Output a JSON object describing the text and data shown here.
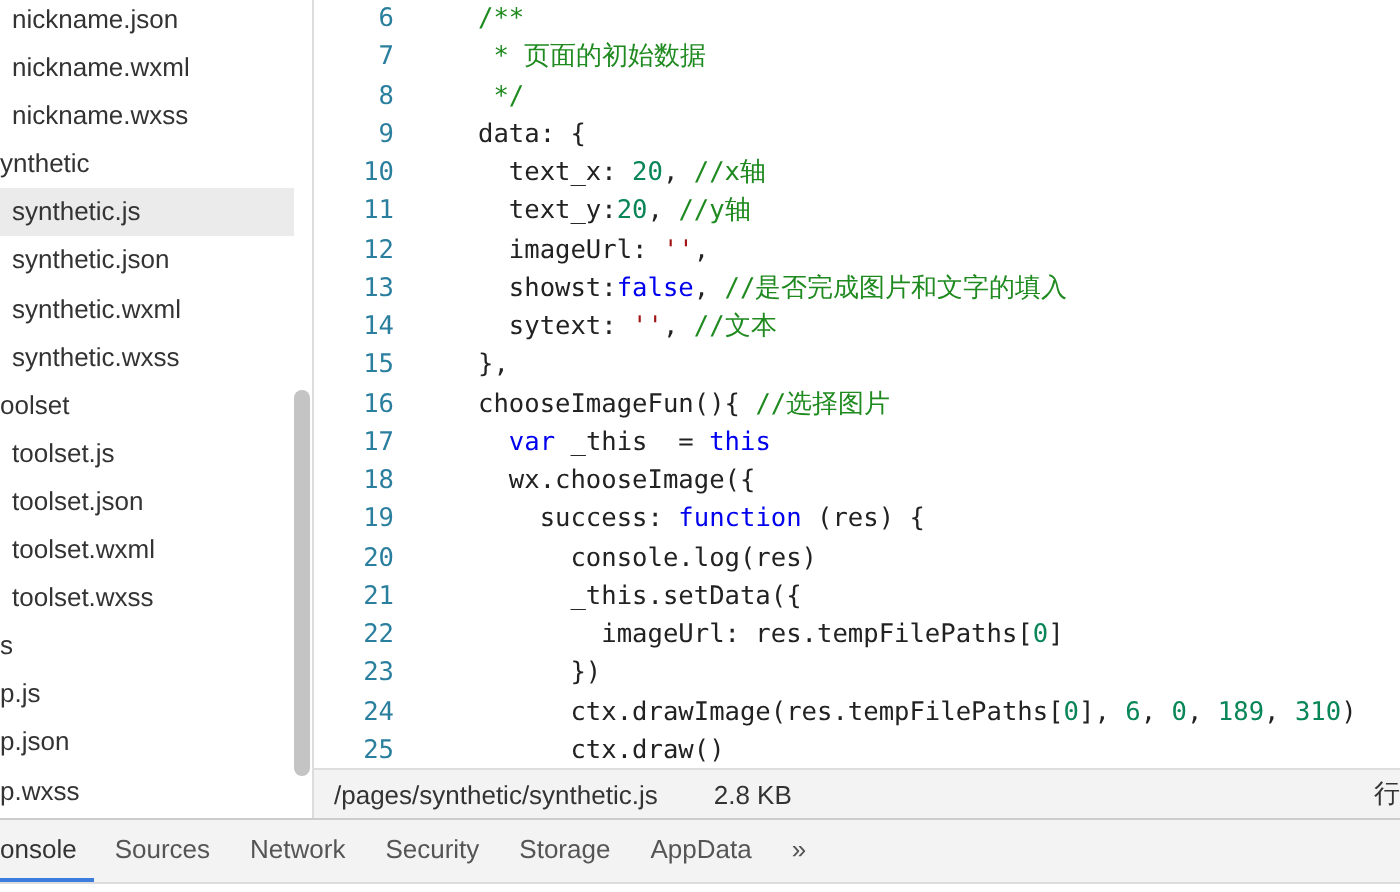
{
  "sidebar": {
    "tree": [
      {
        "children": [
          {
            "label": "nickname.json",
            "selected": false
          },
          {
            "label": "nickname.wxml",
            "selected": false
          },
          {
            "label": "nickname.wxss",
            "selected": false
          }
        ]
      },
      {
        "label": "ynthetic",
        "selected": false,
        "children": [
          {
            "label": "synthetic.js",
            "selected": true
          },
          {
            "label": "synthetic.json",
            "selected": false
          },
          {
            "label": "synthetic.wxml",
            "selected": false
          },
          {
            "label": "synthetic.wxss",
            "selected": false
          }
        ]
      },
      {
        "label": "oolset",
        "selected": false,
        "children": [
          {
            "label": "toolset.js",
            "selected": false
          },
          {
            "label": "toolset.json",
            "selected": false
          },
          {
            "label": "toolset.wxml",
            "selected": false
          },
          {
            "label": "toolset.wxss",
            "selected": false
          }
        ]
      },
      {
        "label": "s",
        "selected": false
      },
      {
        "label": "p.js",
        "selected": false
      },
      {
        "label": "p.json",
        "selected": false
      },
      {
        "label": "p.wxss",
        "selected": false
      }
    ]
  },
  "editor": {
    "lines": [
      {
        "number": "6",
        "tokens": [
          {
            "kind": "comment",
            "text": "/**"
          }
        ]
      },
      {
        "number": "7",
        "tokens": [
          {
            "kind": "comment",
            "text": " * 页面的初始数据"
          }
        ]
      },
      {
        "number": "8",
        "tokens": [
          {
            "kind": "comment",
            "text": " */"
          }
        ]
      },
      {
        "number": "9",
        "tokens": [
          {
            "kind": "plain",
            "text": "data: {"
          }
        ]
      },
      {
        "number": "10",
        "tokens": [
          {
            "kind": "plain",
            "text": "  text_x: "
          },
          {
            "kind": "number",
            "text": "20"
          },
          {
            "kind": "plain",
            "text": ", "
          },
          {
            "kind": "comment",
            "text": "//x轴"
          }
        ]
      },
      {
        "number": "11",
        "tokens": [
          {
            "kind": "plain",
            "text": "  text_y:"
          },
          {
            "kind": "number",
            "text": "20"
          },
          {
            "kind": "plain",
            "text": ", "
          },
          {
            "kind": "comment",
            "text": "//y轴"
          }
        ]
      },
      {
        "number": "12",
        "tokens": [
          {
            "kind": "plain",
            "text": "  imageUrl: "
          },
          {
            "kind": "string",
            "text": "''"
          },
          {
            "kind": "plain",
            "text": ","
          }
        ]
      },
      {
        "number": "13",
        "tokens": [
          {
            "kind": "plain",
            "text": "  showst:"
          },
          {
            "kind": "keyword",
            "text": "false"
          },
          {
            "kind": "plain",
            "text": ", "
          },
          {
            "kind": "comment",
            "text": "//是否完成图片和文字的填入"
          }
        ]
      },
      {
        "number": "14",
        "tokens": [
          {
            "kind": "plain",
            "text": "  sytext: "
          },
          {
            "kind": "string",
            "text": "''"
          },
          {
            "kind": "plain",
            "text": ", "
          },
          {
            "kind": "comment",
            "text": "//文本"
          }
        ]
      },
      {
        "number": "15",
        "tokens": [
          {
            "kind": "plain",
            "text": "},"
          }
        ]
      },
      {
        "number": "16",
        "tokens": [
          {
            "kind": "plain",
            "text": "chooseImageFun(){ "
          },
          {
            "kind": "comment",
            "text": "//选择图片"
          }
        ]
      },
      {
        "number": "17",
        "tokens": [
          {
            "kind": "keyword",
            "text": "  var"
          },
          {
            "kind": "plain",
            "text": " _this  = "
          },
          {
            "kind": "keyword",
            "text": "this"
          }
        ]
      },
      {
        "number": "18",
        "tokens": [
          {
            "kind": "plain",
            "text": "  wx.chooseImage({"
          }
        ]
      },
      {
        "number": "19",
        "tokens": [
          {
            "kind": "plain",
            "text": "    success: "
          },
          {
            "kind": "keyword",
            "text": "function"
          },
          {
            "kind": "plain",
            "text": " (res) {"
          }
        ]
      },
      {
        "number": "20",
        "tokens": [
          {
            "kind": "plain",
            "text": "      console.log(res)"
          }
        ]
      },
      {
        "number": "21",
        "tokens": [
          {
            "kind": "plain",
            "text": "      _this.setData({"
          }
        ]
      },
      {
        "number": "22",
        "tokens": [
          {
            "kind": "plain",
            "text": "        imageUrl: res.tempFilePaths["
          },
          {
            "kind": "number",
            "text": "0"
          },
          {
            "kind": "plain",
            "text": "]"
          }
        ]
      },
      {
        "number": "23",
        "tokens": [
          {
            "kind": "plain",
            "text": "      })"
          }
        ]
      },
      {
        "number": "24",
        "tokens": [
          {
            "kind": "plain",
            "text": "      ctx.drawImage(res.tempFilePaths["
          },
          {
            "kind": "number",
            "text": "0"
          },
          {
            "kind": "plain",
            "text": "], "
          },
          {
            "kind": "number",
            "text": "6"
          },
          {
            "kind": "plain",
            "text": ", "
          },
          {
            "kind": "number",
            "text": "0"
          },
          {
            "kind": "plain",
            "text": ", "
          },
          {
            "kind": "number",
            "text": "189"
          },
          {
            "kind": "plain",
            "text": ", "
          },
          {
            "kind": "number",
            "text": "310"
          },
          {
            "kind": "plain",
            "text": ")"
          }
        ]
      },
      {
        "number": "25",
        "tokens": [
          {
            "kind": "plain",
            "text": "      ctx.draw()"
          }
        ]
      }
    ]
  },
  "status_bar": {
    "path": "/pages/synthetic/synthetic.js",
    "size": "2.8 KB",
    "position": "行"
  },
  "panel_tabs": [
    {
      "label": "onsole",
      "selected": true
    },
    {
      "label": "Sources",
      "selected": false
    },
    {
      "label": "Network",
      "selected": false
    },
    {
      "label": "Security",
      "selected": false
    },
    {
      "label": "Storage",
      "selected": false
    },
    {
      "label": "AppData",
      "selected": false
    },
    {
      "label": "»",
      "selected": false
    }
  ]
}
